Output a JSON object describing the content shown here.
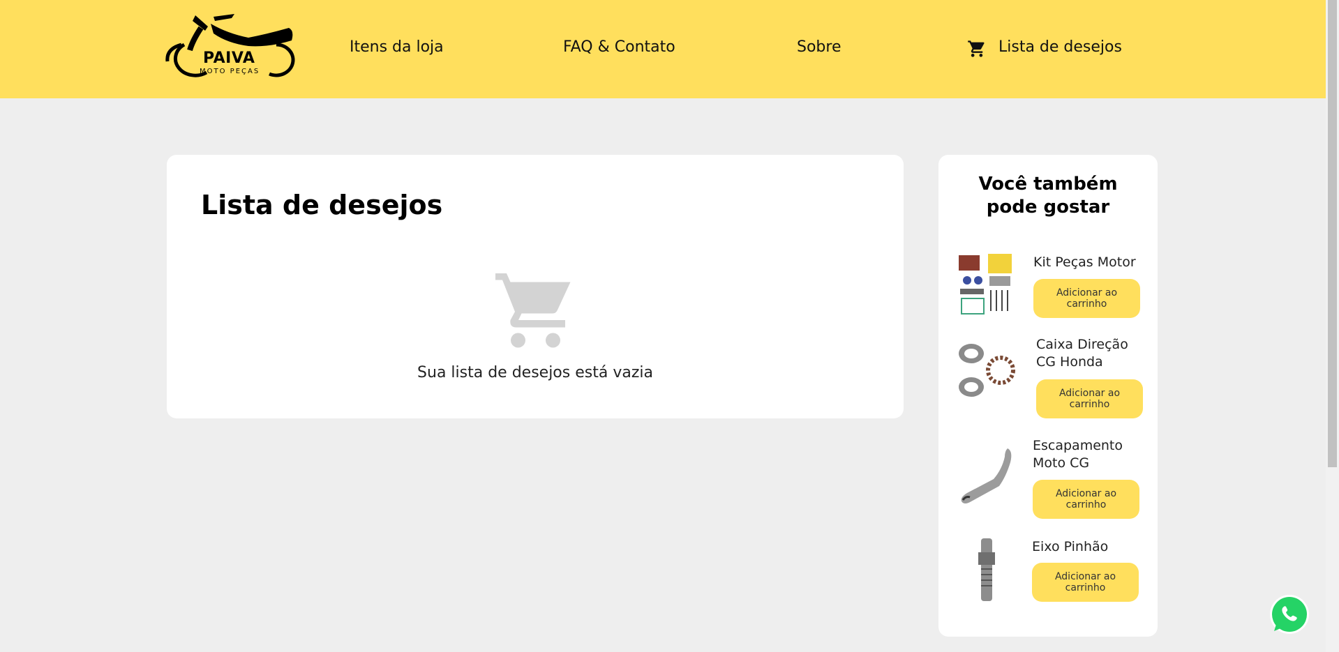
{
  "header": {
    "logo_brand": "PAIVA",
    "logo_sub": "MOTO PEÇAS",
    "nav": [
      {
        "label": "Itens da loja"
      },
      {
        "label": "FAQ & Contato"
      },
      {
        "label": "Sobre"
      },
      {
        "label": "Lista de desejos",
        "icon": "cart-icon"
      }
    ]
  },
  "main": {
    "title": "Lista de desejos",
    "empty_icon": "empty-cart-icon",
    "empty_text": "Sua lista de desejos está vazia"
  },
  "sidebar": {
    "title": "Você também pode gostar",
    "button_label": "Adicionar ao carrinho",
    "products": [
      {
        "name": "Kit Peças Motor",
        "icon": "engine-parts-kit-image"
      },
      {
        "name": "Caixa Direção CG Honda",
        "icon": "bearing-image"
      },
      {
        "name": "Escapamento Moto CG",
        "icon": "exhaust-image"
      },
      {
        "name": "Eixo Pinhão",
        "icon": "shaft-image"
      }
    ]
  },
  "colors": {
    "brand_yellow": "#ffdf5d",
    "background": "#eeeeee",
    "whatsapp_green": "#25d366"
  }
}
